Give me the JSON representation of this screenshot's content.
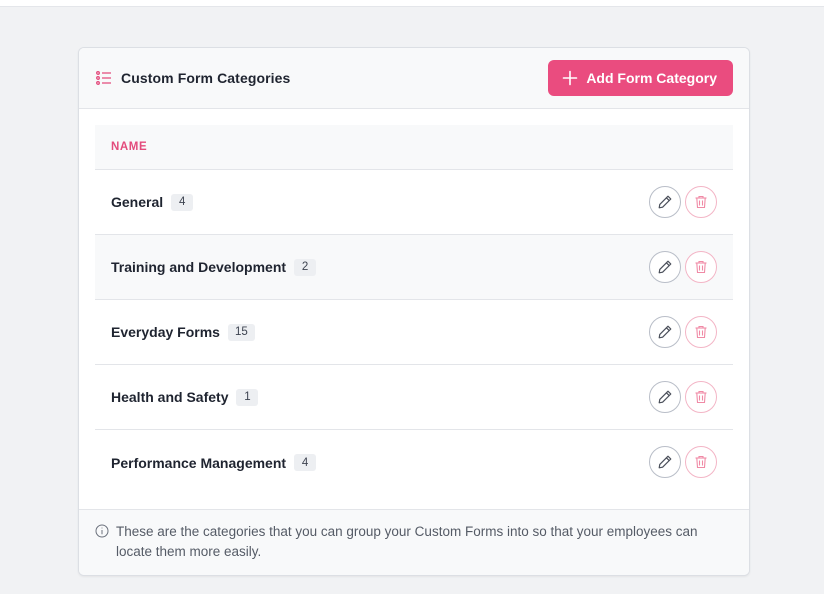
{
  "header": {
    "title": "Custom Form Categories",
    "add_button_label": "Add Form Category"
  },
  "table": {
    "column_name": "NAME",
    "rows": [
      {
        "name": "General",
        "count": "4"
      },
      {
        "name": "Training and Development",
        "count": "2"
      },
      {
        "name": "Everyday Forms",
        "count": "15"
      },
      {
        "name": "Health and Safety",
        "count": "1"
      },
      {
        "name": "Performance Management",
        "count": "4"
      }
    ]
  },
  "footer": {
    "info_text": "These are the categories that you can group your Custom Forms into so that your employees can locate them more easily."
  },
  "colors": {
    "accent": "#ea4c7f",
    "delete_icon": "#f08aa6",
    "edit_icon": "#4a4f5a"
  },
  "icons": {
    "header": "list-icon",
    "add": "plus-icon",
    "edit": "pencil-icon",
    "delete": "trash-icon",
    "info": "info-icon"
  }
}
